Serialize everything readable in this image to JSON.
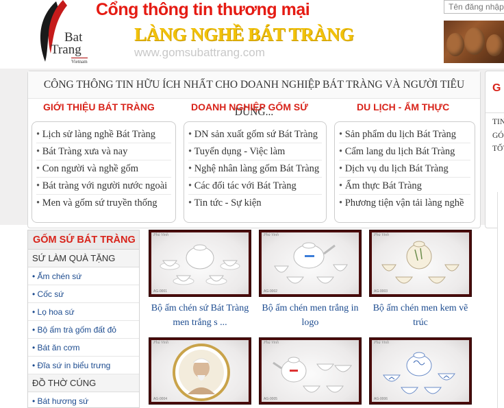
{
  "header": {
    "logo": {
      "line1": "Bat",
      "line2": "Trang",
      "line3": "Vietnam"
    },
    "title_line1": "Cổng thông tin thương mại",
    "title_line2": "LÀNG NGHỀ BÁT TRÀNG",
    "url": "www.gomsubattrang.com",
    "login_placeholder": "Tên đăng nhập"
  },
  "tagline": "CÔNG THÔNG TIN HỮU ÍCH NHẤT CHO DOANH NGHIỆP BÁT TRÀNG VÀ NGƯỜI TIÊU DÙNG...",
  "columns": [
    {
      "heading": "GIỚI THIỆU BÁT TRÀNG",
      "items": [
        "Lịch sử làng nghề Bát Tràng",
        "Bát Tràng xưa và nay",
        "Con người và nghề gốm",
        "Bát tràng với người nước ngoài",
        "Men và gốm sứ truyền thống"
      ]
    },
    {
      "heading": "DOANH NGHIỆP GỐM SỨ",
      "items": [
        "DN sản xuất gốm sứ Bát Tràng",
        "Tuyển dụng - Việc làm",
        "Nghệ nhân làng gốm Bát Tràng",
        "Các đối tác với Bát Tràng",
        "Tin tức - Sự kiện"
      ]
    },
    {
      "heading": "DU LỊCH - ẨM THỰC",
      "items": [
        "Sản phẩm du lịch Bát Tràng",
        "Cẩm lang du lịch Bát Tràng",
        "Dịch vụ du lịch Bát Tràng",
        "Ẩm thực Bát Tràng",
        "Phương tiện vận tải làng nghề"
      ]
    }
  ],
  "right_panel": {
    "heading_fragment": "G",
    "lines": [
      "TIN",
      "GÓ",
      "TỐT"
    ]
  },
  "sidebar": {
    "heading": "GỐM SỨ BÁT TRÀNG",
    "categories": [
      {
        "label": "SỨ LÀM QUÀ TẶNG",
        "items": [
          "Ấm chén sứ",
          "Cốc sứ",
          "Lọ hoa sứ",
          "Bộ ấm trà gốm đất đỏ",
          "Bát ăn cơm",
          "Đĩa sứ in biểu trưng"
        ]
      },
      {
        "label": "ĐỒ THỜ CÚNG",
        "items": [
          "Bát hương sứ"
        ]
      }
    ]
  },
  "products": [
    {
      "title": "Bộ ấm chén sứ Bát Tràng men trắng s ...",
      "watermark": "Phú Vinh",
      "code": "AG-0001",
      "variant": "white"
    },
    {
      "title": "Bộ ấm chén men trắng in logo",
      "watermark": "Phú Vinh",
      "code": "AG-0002",
      "variant": "white"
    },
    {
      "title": "Bộ ấm chén men kem vẽ trúc",
      "watermark": "Phú Vinh",
      "code": "AG-0003",
      "variant": "cream"
    },
    {
      "title": "",
      "watermark": "Phú Vinh",
      "code": "AG-0004",
      "variant": "portrait"
    },
    {
      "title": "",
      "watermark": "Phú Vinh",
      "code": "AG-0005",
      "variant": "white"
    },
    {
      "title": "",
      "watermark": "Phú Vinh",
      "code": "AG-0006",
      "variant": "blue"
    }
  ],
  "colors": {
    "accent_red": "#d8231a",
    "title_yellow": "#f2c20a",
    "link_blue": "#1c4b8f",
    "frame_maroon": "#4a0c0c"
  }
}
